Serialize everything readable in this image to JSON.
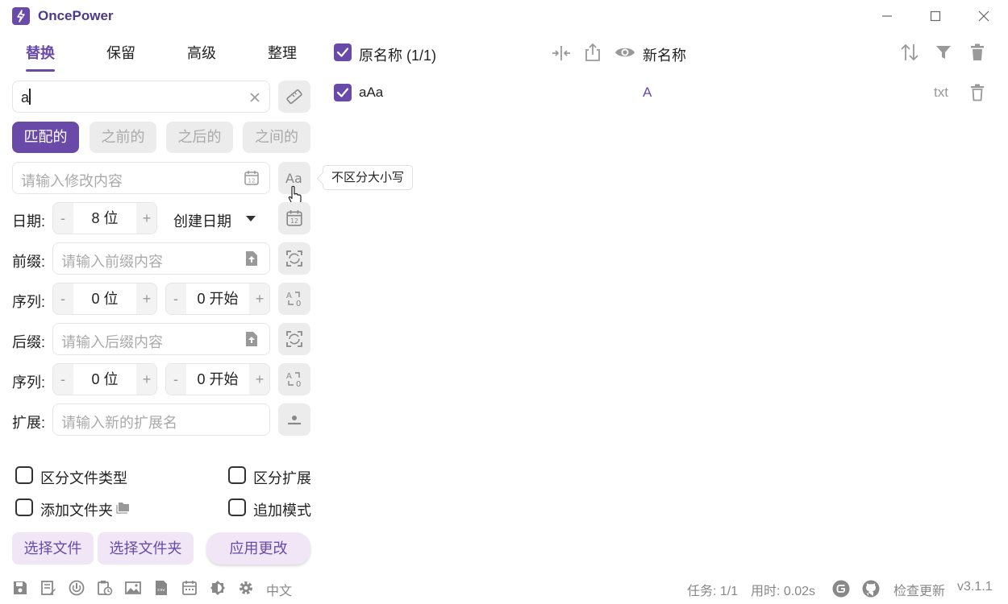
{
  "app": {
    "title": "OncePower",
    "brand_color": "#6a4aa8"
  },
  "tabs": [
    {
      "label": "替换",
      "active": true
    },
    {
      "label": "保留",
      "active": false
    },
    {
      "label": "高级",
      "active": false
    },
    {
      "label": "整理",
      "active": false
    }
  ],
  "search": {
    "value": "a"
  },
  "match_modes": [
    "匹配的",
    "之前的",
    "之后的",
    "之间的"
  ],
  "replace_input": {
    "placeholder": "请输入修改内容"
  },
  "tooltip": "不区分大小写",
  "date": {
    "label": "日期:",
    "digits": "8 位",
    "type": "创建日期"
  },
  "prefix": {
    "label": "前缀:",
    "placeholder": "请输入前缀内容"
  },
  "prefix_seq": {
    "label": "序列:",
    "digits": "0 位",
    "start": "0 开始"
  },
  "suffix": {
    "label": "后缀:",
    "placeholder": "请输入后缀内容"
  },
  "suffix_seq": {
    "label": "序列:",
    "digits": "0 位",
    "start": "0 开始"
  },
  "extension": {
    "label": "扩展:",
    "placeholder": "请输入新的扩展名"
  },
  "stepper": {
    "minus": "-",
    "plus": "+"
  },
  "options": {
    "file_type": "区分文件类型",
    "ext": "区分扩展",
    "add_folder": "添加文件夹",
    "append": "追加模式"
  },
  "actions": {
    "select_files": "选择文件",
    "select_folder": "选择文件夹",
    "apply": "应用更改"
  },
  "list_header": {
    "original": "原名称 (1/1)",
    "new": "新名称"
  },
  "files": [
    {
      "original": "aAa",
      "new": "A",
      "ext": "txt"
    }
  ],
  "statusbar": {
    "language": "中文",
    "tasks": "任务: 1/1",
    "time": "用时: 0.02s",
    "update": "检查更新",
    "version": "v3.1.1"
  }
}
